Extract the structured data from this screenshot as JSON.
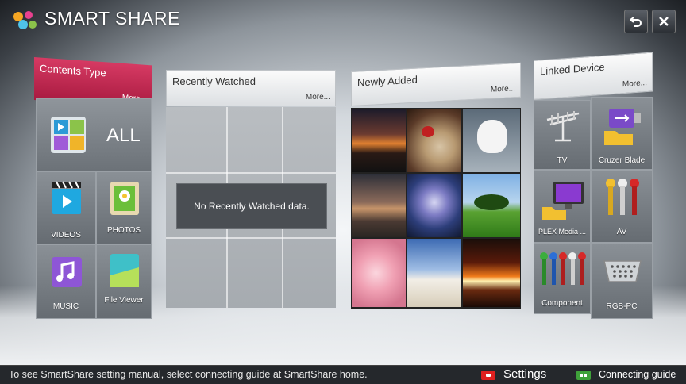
{
  "header": {
    "title": "SMART SHARE",
    "back_icon": "return-arrow-icon",
    "close_icon": "close-icon"
  },
  "contents_type": {
    "title": "Contents Type",
    "more": "More...",
    "all_label": "ALL",
    "items": [
      {
        "label": "VIDEOS",
        "icon": "video-clapper-icon"
      },
      {
        "label": "PHOTOS",
        "icon": "photo-frame-icon"
      },
      {
        "label": "MUSIC",
        "icon": "music-note-icon"
      },
      {
        "label": "File Viewer",
        "icon": "file-viewer-icon"
      }
    ]
  },
  "recently_watched": {
    "title": "Recently Watched",
    "more": "More...",
    "empty_message": "No Recently Watched data."
  },
  "newly_added": {
    "title": "Newly Added",
    "more": "More..."
  },
  "linked_device": {
    "title": "Linked Device",
    "more": "More...",
    "devices": [
      {
        "label": "TV",
        "icon": "antenna-icon"
      },
      {
        "label": "Cruzer Blade",
        "icon": "usb-drive-icon"
      },
      {
        "label": "PLEX Media ...",
        "icon": "media-server-icon"
      },
      {
        "label": "AV",
        "icon": "av-cable-icon"
      },
      {
        "label": "Component",
        "icon": "component-cable-icon"
      },
      {
        "label": "RGB-PC",
        "icon": "rgb-connector-icon"
      }
    ]
  },
  "footer": {
    "message": "To see SmartShare setting manual, select connecting guide at SmartShare home.",
    "settings_label": "Settings",
    "connecting_label": "Connecting guide"
  },
  "colors": {
    "contents_header": "#c8234f",
    "settings_key": "#e02020",
    "connecting_key": "#3fa23a"
  }
}
